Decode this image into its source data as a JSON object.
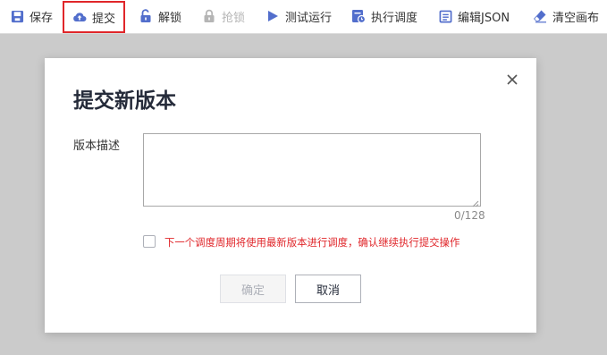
{
  "toolbar": {
    "items": [
      {
        "label": "保存",
        "icon": "save-icon",
        "disabled": false
      },
      {
        "label": "提交",
        "icon": "cloud-upload-icon",
        "disabled": false,
        "highlighted": true
      },
      {
        "label": "解锁",
        "icon": "unlock-icon",
        "disabled": false
      },
      {
        "label": "抢锁",
        "icon": "lock-icon",
        "disabled": true
      },
      {
        "label": "测试运行",
        "icon": "play-icon",
        "disabled": false
      },
      {
        "label": "执行调度",
        "icon": "schedule-icon",
        "disabled": false
      },
      {
        "label": "编辑JSON",
        "icon": "json-edit-icon",
        "disabled": false
      },
      {
        "label": "清空画布",
        "icon": "eraser-icon",
        "disabled": false
      }
    ]
  },
  "dialog": {
    "title": "提交新版本",
    "description_label": "版本描述",
    "description_value": "",
    "counter": "0/128",
    "checkbox_checked": false,
    "checkbox_label": "下一个调度周期将使用最新版本进行调度，确认继续执行提交操作",
    "confirm_label": "确定",
    "confirm_disabled": true,
    "cancel_label": "取消"
  },
  "colors": {
    "icon_primary": "#526ecc",
    "icon_disabled": "#b5b5b5",
    "highlight_border": "#e0262a",
    "warning_text": "#e0262a",
    "overlay": "#cbcbcb"
  }
}
